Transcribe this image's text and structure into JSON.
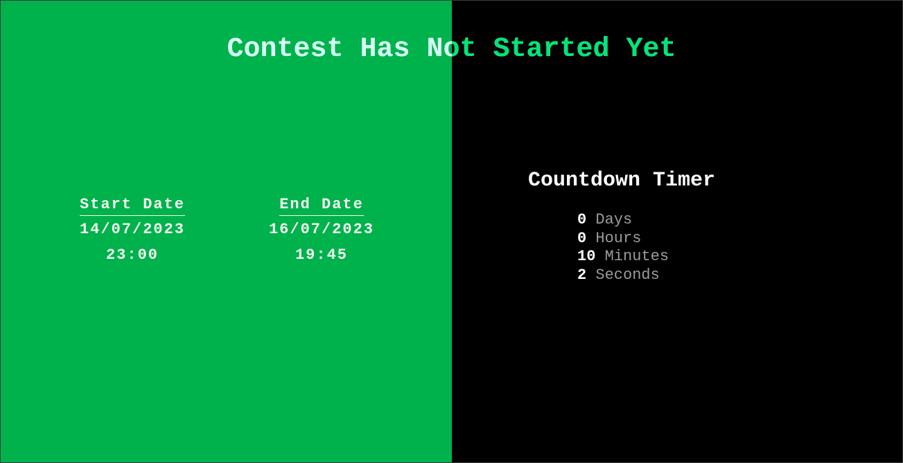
{
  "title": "Contest Has Not Started Yet",
  "colors": {
    "left_panel": "#00b24c",
    "right_panel": "#000000",
    "title_on_green": "#d8fff5",
    "title_on_black": "#00e676",
    "unit_text": "#9b9b9b"
  },
  "start": {
    "label": "Start Date",
    "date": "14/07/2023",
    "time": "23:00"
  },
  "end": {
    "label": "End Date",
    "date": "16/07/2023",
    "time": "19:45"
  },
  "countdown": {
    "title": "Countdown Timer",
    "rows": [
      {
        "value": "0",
        "unit": "Days"
      },
      {
        "value": "0",
        "unit": "Hours"
      },
      {
        "value": "10",
        "unit": "Minutes"
      },
      {
        "value": "2",
        "unit": "Seconds"
      }
    ]
  }
}
